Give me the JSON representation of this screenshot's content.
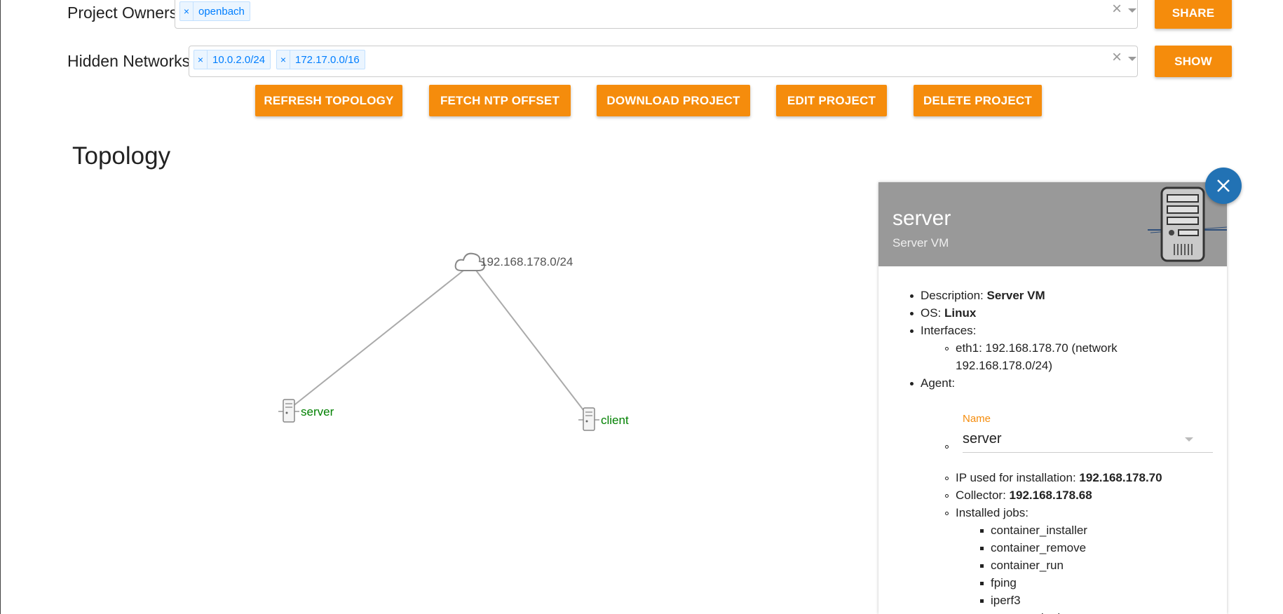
{
  "owners": {
    "label": "Project Owners",
    "tags": [
      "openbach"
    ],
    "button": "SHARE"
  },
  "hidden": {
    "label": "Hidden Networks",
    "tags": [
      "10.0.2.0/24",
      "172.17.0.0/16"
    ],
    "button": "SHOW"
  },
  "clear_glyph": "×",
  "actions": [
    "REFRESH TOPOLOGY",
    "FETCH NTP OFFSET",
    "DOWNLOAD PROJECT",
    "EDIT PROJECT",
    "DELETE PROJECT"
  ],
  "topology": {
    "title": "Topology",
    "network_label": "192.168.178.0/24",
    "nodes": [
      "server",
      "client"
    ],
    "colors": {
      "node_label": "#008000",
      "edge": "#aaaaaa",
      "network_label": "#555555"
    }
  },
  "panel": {
    "title": "server",
    "subtitle": "Server VM",
    "description_label": "Description: ",
    "description": "Server VM",
    "os_label": "OS: ",
    "os": "Linux",
    "interfaces_label": "Interfaces:",
    "interface_line1": "eth1: 192.168.178.70 (network",
    "interface_line2": "192.168.178.0/24)",
    "agent_label": "Agent:",
    "name_field_label": "Name",
    "name_field_value": "server",
    "ip_label": "IP used for installation: ",
    "ip": "192.168.178.70",
    "collector_label": "Collector: ",
    "collector": "192.168.178.68",
    "jobs_label": "Installed jobs:",
    "jobs": [
      "container_installer",
      "container_remove",
      "container_run",
      "fping",
      "iperf3",
      "rate_monitoring"
    ]
  },
  "colors": {
    "accent": "#f58c0c",
    "close": "#2272b4",
    "header": "#999999",
    "tag_text": "#007eff"
  }
}
